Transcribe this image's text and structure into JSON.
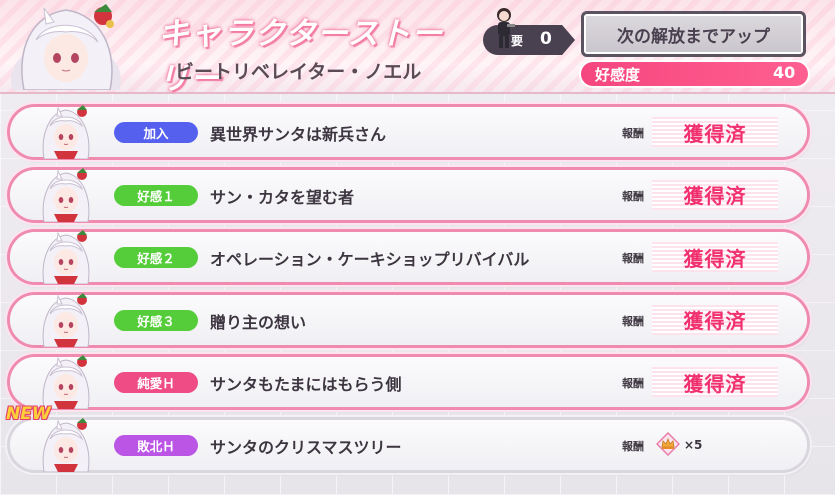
{
  "header": {
    "title": "キャラクターストーリー",
    "character_name": "ビートリベレイター・ノエル",
    "requirement_label": "要",
    "requirement_count": "0",
    "unlock_button_label": "次の解放までアップ",
    "affection_label": "好感度",
    "affection_value": "40"
  },
  "colors": {
    "badge_join": "#5560ee",
    "badge_affection": "#55cc3a",
    "badge_pure_love": "#ef4c86",
    "badge_defeat": "#bb55e6",
    "accent_pink": "#f0306f"
  },
  "reward_label": "報酬",
  "stories": [
    {
      "badge": "加入",
      "badge_color": "#5560ee",
      "title": "異世界サンタは新兵さん",
      "reward": "獲得済",
      "is_new": false
    },
    {
      "badge": "好感１",
      "badge_color": "#55cc3a",
      "title": "サン・カタを望む者",
      "reward": "獲得済",
      "is_new": false
    },
    {
      "badge": "好感２",
      "badge_color": "#55cc3a",
      "title": "オペレーション・ケーキショップリバイバル",
      "reward": "獲得済",
      "is_new": false
    },
    {
      "badge": "好感３",
      "badge_color": "#55cc3a",
      "title": "贈り主の想い",
      "reward": "獲得済",
      "is_new": false
    },
    {
      "badge": "純愛Ｈ",
      "badge_color": "#ef4c86",
      "title": "サンタもたまにはもらう側",
      "reward": "獲得済",
      "is_new": false
    },
    {
      "badge": "敗北Ｈ",
      "badge_color": "#bb55e6",
      "title": "サンタのクリスマスツリー",
      "reward_item_icon": "crown-crystal-icon",
      "reward_item_count": "×5",
      "is_new": true,
      "new_label": "NEW"
    }
  ]
}
